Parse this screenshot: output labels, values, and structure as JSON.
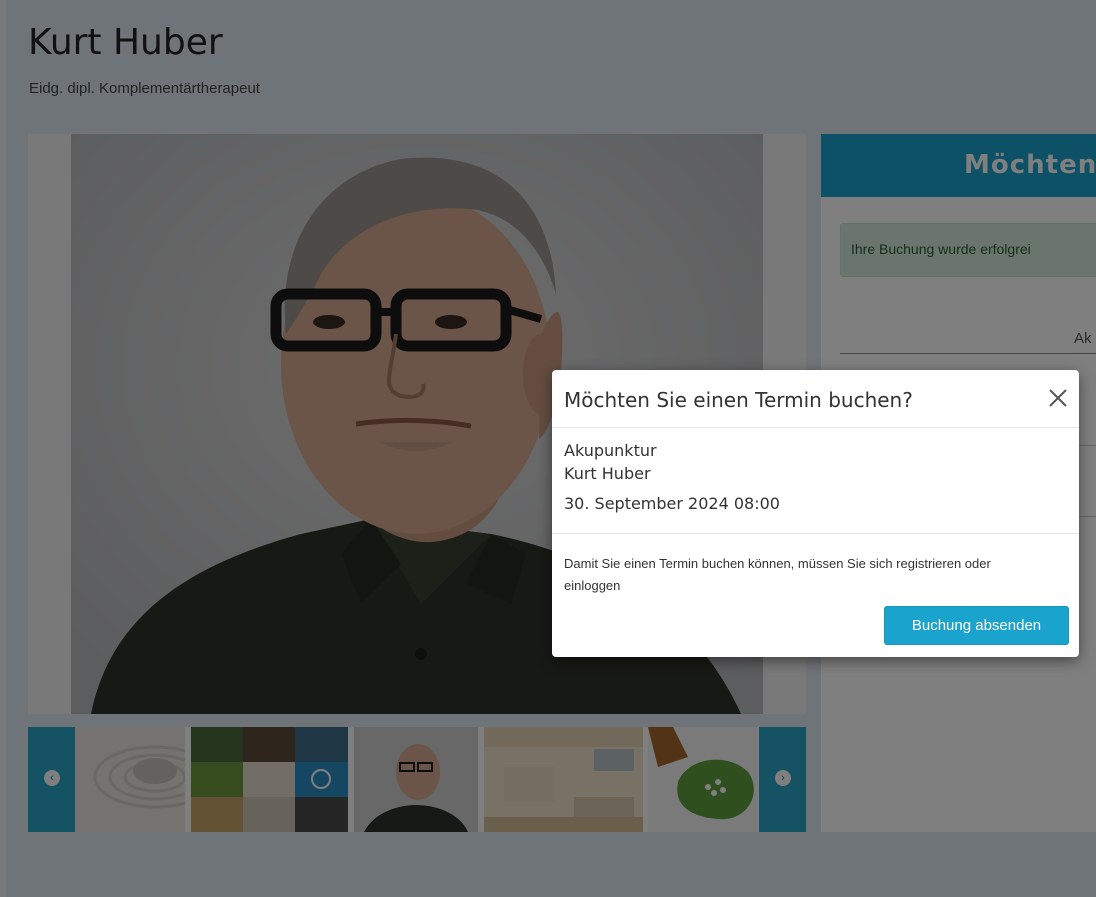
{
  "page": {
    "title": "Kurt Huber",
    "subtitle": "Eidg. dipl. Komplementärtherapeut"
  },
  "gallery": {
    "prev_icon": "chevron-left-circle-icon",
    "next_icon": "chevron-right-circle-icon",
    "thumbnails": [
      "zen-stones",
      "collage",
      "portrait",
      "clinic-room",
      "homeopathic-globules"
    ]
  },
  "booking_panel": {
    "header": "Möchten",
    "success_message": "Ihre Buchung wurde erfolgrei",
    "tab_label": "Ak"
  },
  "modal": {
    "title": "Möchten Sie einen Termin buchen?",
    "treatment": "Akupunktur",
    "therapist": "Kurt Huber",
    "datetime": "30. September 2024 08:00",
    "info_text": "Damit Sie einen Termin buchen können, müssen Sie sich registrieren oder einloggen",
    "submit_label": "Buchung absenden",
    "close_icon": "close-icon"
  },
  "colors": {
    "accent": "#1aa3cc",
    "success_bg": "#d4edda",
    "thumb_arrow": "#2aa6c9"
  }
}
